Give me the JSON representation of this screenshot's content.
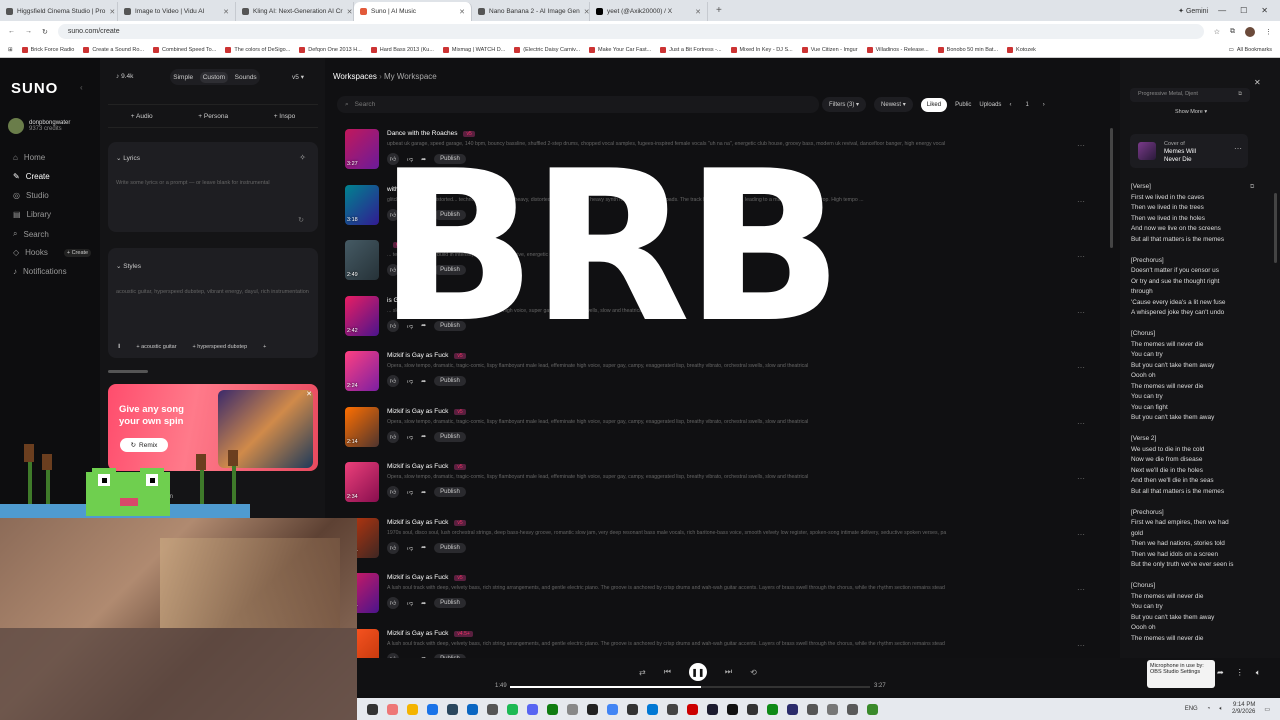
{
  "tabs": [
    "Higgsfield Cinema Studio | Pro",
    "Image to Video | Vidu AI",
    "Kling AI: Next-Generation AI Cr",
    "Suno | AI Music",
    "Nano Banana 2 - AI Image Gen",
    "yeet (@Axik20000) / X"
  ],
  "gemini": "Gemini",
  "url": "suno.com/create",
  "bookmarks": [
    "Brick Force Radio",
    "Create a Sound Ro...",
    "Combined Speed To...",
    "The colors of DeSigo...",
    "Defqon One 2013 H...",
    "Hard Bass 2013 (Ku...",
    "Mixmag | WATCH D...",
    "(Electric Daisy Carniv...",
    "Make Your Car Fast...",
    "Just a Bit Fortress -...",
    "Mixed In Key - DJ S...",
    "Vue Citizen - Imgur",
    "Villadinos - Release...",
    "Bonobo 50 min Bat...",
    "Kotozek"
  ],
  "all_bookmarks": "All Bookmarks",
  "logo": "SUNO",
  "user": {
    "name": "donpbongwater",
    "credits": "9373 credits"
  },
  "nav": [
    "Home",
    "Create",
    "Studio",
    "Library",
    "Search",
    "Hooks",
    "Notifications"
  ],
  "hooks_badge": "+ Create",
  "panel": {
    "count": "9.4k",
    "modes": [
      "Simple",
      "Custom",
      "Sounds"
    ],
    "version": "v5",
    "buttons": [
      "Audio",
      "Persona",
      "Inspo"
    ],
    "lyrics_label": "Lyrics",
    "lyrics_placeholder": "Write some lyrics or a prompt — or leave blank for instrumental",
    "styles_label": "Styles",
    "styles_text": "acoustic guitar, hyperspeed dubstep, vibrant energy, dayul, rich instrumentation",
    "tags": [
      "acoustic guitar",
      "hyperspeed dubstep"
    ],
    "promo_title": "Give any song your own spin",
    "remix": "Remix",
    "promo_sub": "ption"
  },
  "breadcrumb": {
    "root": "Workspaces",
    "current": "My Workspace"
  },
  "search_placeholder": "Search",
  "filters": {
    "filter": "Filters (3)",
    "sort": "Newest",
    "liked": "Liked",
    "public": "Public",
    "uploads": "Uploads",
    "page": "1"
  },
  "publish": "Publish",
  "songs": [
    {
      "title": "Dance with the Roaches",
      "tag": "v5",
      "dur": "3:27",
      "desc": "upbeat uk garage, speed garage, 140 bpm, bouncy bassline, shuffled 2-step drums, chopped vocal samples, fugees-inspired female vocals \"uh na na\", energetic club house, groovy bass, modern uk revival, dancefloor banger, high energy vocal"
    },
    {
      "title": "with the Roaches",
      "tag": "v5",
      "dur": "3:18",
      "desc": "glitch hardcore with distorted... techno, 170bpm ...ing a heavy, distorted 4/4 kick drum ... heavy synth riffs ..., atmospheric pads. The track builds in intensity, leading to a massive, energetic drop. High tempo ..."
    },
    {
      "title": "",
      "tag": "v5",
      "dur": "2:49",
      "desc": "... techno, 170bpm ... build in intensity, leading to a massive, energetic drop. High tempo ..."
    },
    {
      "title": "is Gay as Fuck",
      "tag": "v5",
      "dur": "2:42",
      "desc": "... slow tempo, dramatic, tragi-comic ... effeminate high voice, super gay ... orchestral swells, slow and theatrical"
    },
    {
      "title": "Mizkif is Gay as Fuck",
      "tag": "v5",
      "dur": "2:24",
      "desc": "Opera, slow tempo, dramatic, tragic-comic, lispy flamboyant male lead, effeminate high voice, super gay, campy, exaggerated lisp, breathy vibrato, orchestral swells, slow and theatrical"
    },
    {
      "title": "Mizkif is Gay as Fuck",
      "tag": "v5",
      "dur": "2:14",
      "desc": "Opera, slow tempo, dramatic, tragic-comic, lispy flamboyant male lead, effeminate high voice, super gay, campy, exaggerated lisp, breathy vibrato, orchestral swells, slow and theatrical"
    },
    {
      "title": "Mizkif is Gay as Fuck",
      "tag": "v5",
      "dur": "2:34",
      "desc": "Opera, slow tempo, dramatic, tragic-comic, lispy flamboyant male lead, effeminate high voice, super gay, campy, exaggerated lisp, breathy vibrato, orchestral swells, slow and theatrical"
    },
    {
      "title": "Mizkif is Gay as Fuck",
      "tag": "v5",
      "dur": "4:47",
      "desc": "1970s soul, disco soul, lush orchestral strings, deep bass-heavy groove, romantic slow jam, very deep resonant bass male vocals, rich baritone-bass voice, smooth velvety low register, spoken-song intimate delivery, seductive spoken verses, pa"
    },
    {
      "title": "Mizkif is Gay as Fuck",
      "tag": "v5",
      "dur": "3:27",
      "desc": "A lush soul track with deep, velvety bass, rich string arrangements, and gentle electric piano. The groove is anchored by crisp drums and wah-wah guitar accents. Layers of brass swell through the chorus, while the rhythm section remains stead"
    },
    {
      "title": "Mizkif is Gay as Fuck",
      "tag": "v4.5+",
      "dur": "",
      "desc": "A lush soul track with deep, velvety bass, rich string arrangements, and gentle electric piano. The groove is anchored by crisp drums and wah-wah guitar accents. Layers of brass swell through the chorus, while the rhythm section remains stead"
    }
  ],
  "overlay": "BRB",
  "right": {
    "style_tag": "Progressive Metal, Djent",
    "show_more": "Show More",
    "cover_label": "Cover of",
    "cover_title": "Memes Will Never Die",
    "lyrics": "[Verse]\nFirst we lived in the caves\nThen we lived in the trees\nThen we lived in the holes\nAnd now we live on the screens\nBut all that matters is the memes\n\n[Prechorus]\nDoesn't matter if you censor us\nOr try and sue the thought right\nthrough\n'Cause every idea's a lit new fuse\nA whispered joke they can't undo\n\n[Chorus]\nThe memes will never die\nYou can try\nBut you can't take them away\nOooh oh\nThe memes will never die\nYou can try\nYou can fight\nBut you can't take them away\n\n[Verse 2]\nWe used to die in the cold\nNow we die from disease\nNext we'll die in the holes\nAnd then we'll die in the seas\nBut all that matters is the memes\n\n[Prechorus]\nFirst we had empires, then we had\ngold\nThen we had nations, stories told\nThen we had idols on a screen\nBut the only truth we've ever seen is\n\n[Chorus]\nThe memes will never die\nYou can try\nBut you can't take them away\nOooh oh\nThe memes will never die"
  },
  "player": {
    "elapsed": "1:49",
    "total": "3:27",
    "progress": 0.53
  },
  "tooltip": "Microphone in use by: OBS Studio Settings",
  "taskbar": {
    "lang": "ENG",
    "time": "9:14 PM",
    "date": "2/9/2026"
  }
}
